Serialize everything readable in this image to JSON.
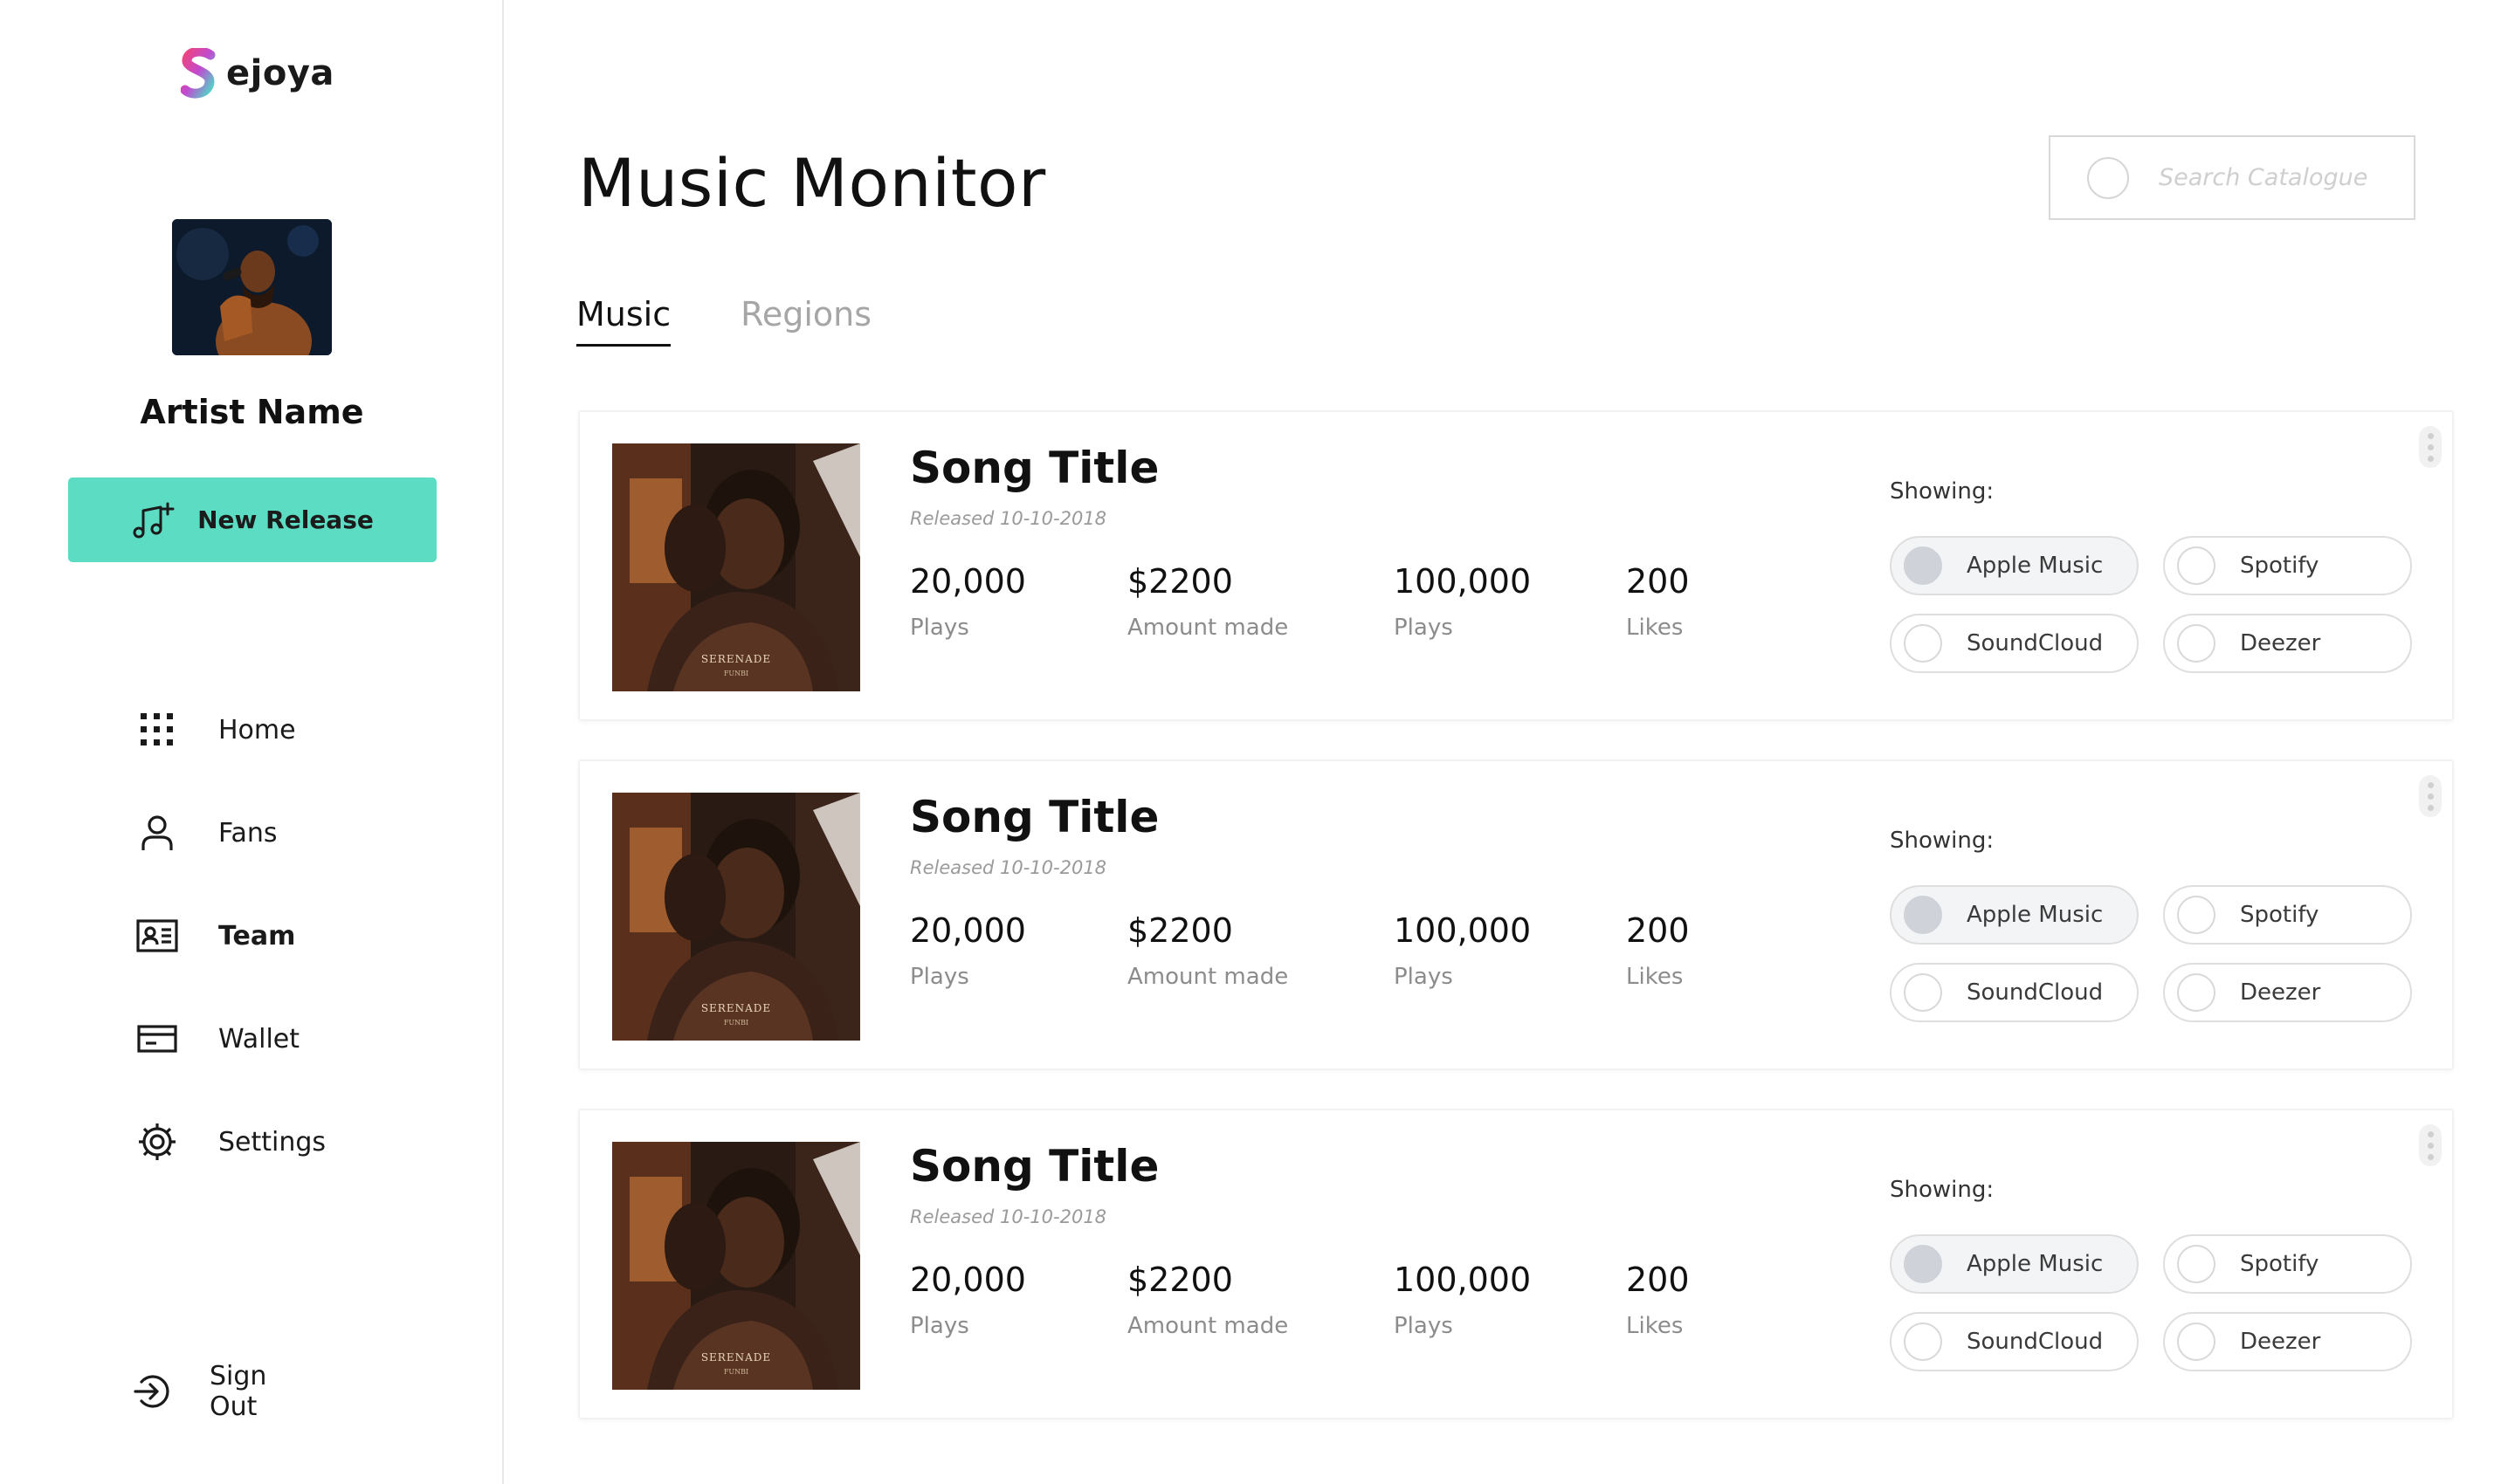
{
  "brand": {
    "name": "ejoya"
  },
  "artist": {
    "name": "Artist Name"
  },
  "sidebar": {
    "new_release_label": "New Release",
    "items": [
      {
        "label": "Home",
        "icon": "grid-icon",
        "active": false
      },
      {
        "label": "Fans",
        "icon": "user-icon",
        "active": false
      },
      {
        "label": "Team",
        "icon": "id-card-icon",
        "active": true
      },
      {
        "label": "Wallet",
        "icon": "wallet-icon",
        "active": false
      },
      {
        "label": "Settings",
        "icon": "gear-icon",
        "active": false
      }
    ],
    "sign_out_label": "Sign Out"
  },
  "main": {
    "title": "Music Monitor",
    "search": {
      "placeholder": "Search Catalogue"
    },
    "tabs": [
      {
        "label": "Music",
        "active": true
      },
      {
        "label": "Regions",
        "active": false
      }
    ],
    "showing_label": "Showing:",
    "platforms": [
      "Apple Music",
      "Spotify",
      "SoundCloud",
      "Deezer"
    ],
    "songs": [
      {
        "title": "Song Title",
        "released": "Released 10-10-2018",
        "cover_title": "SERENADE",
        "cover_subtitle": "FUNBI",
        "stats": [
          {
            "value": "20,000",
            "label": "Plays"
          },
          {
            "value": "$2200",
            "label": "Amount made"
          },
          {
            "value": "100,000",
            "label": "Plays"
          },
          {
            "value": "200",
            "label": "Likes"
          }
        ],
        "selected_platform": "Apple Music"
      },
      {
        "title": "Song Title",
        "released": "Released 10-10-2018",
        "cover_title": "SERENADE",
        "cover_subtitle": "FUNBI",
        "stats": [
          {
            "value": "20,000",
            "label": "Plays"
          },
          {
            "value": "$2200",
            "label": "Amount made"
          },
          {
            "value": "100,000",
            "label": "Plays"
          },
          {
            "value": "200",
            "label": "Likes"
          }
        ],
        "selected_platform": "Apple Music"
      },
      {
        "title": "Song Title",
        "released": "Released 10-10-2018",
        "cover_title": "SERENADE",
        "cover_subtitle": "FUNBI",
        "stats": [
          {
            "value": "20,000",
            "label": "Plays"
          },
          {
            "value": "$2200",
            "label": "Amount made"
          },
          {
            "value": "100,000",
            "label": "Plays"
          },
          {
            "value": "200",
            "label": "Likes"
          }
        ],
        "selected_platform": "Apple Music"
      }
    ]
  },
  "colors": {
    "accent": "#5ddcc4",
    "logo_pink": "#f0437d",
    "logo_teal": "#4fd8c8",
    "logo_purple": "#8a4fd8",
    "selected_pill": "#f3f4f6"
  }
}
